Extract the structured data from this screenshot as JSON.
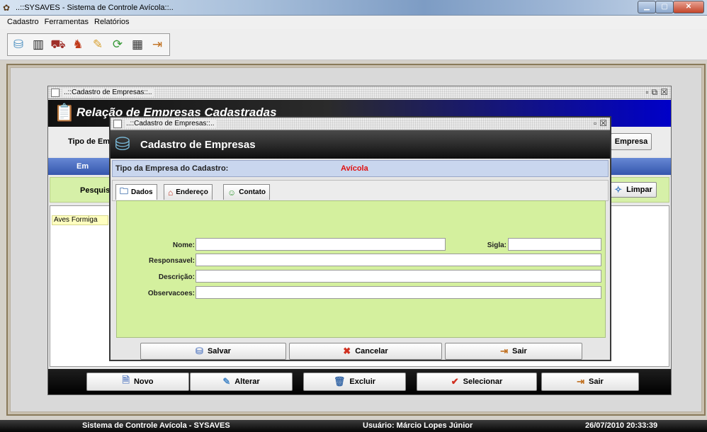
{
  "window": {
    "title": "..::SYSAVES - Sistema de Controle Avícola::.."
  },
  "menu": {
    "items": [
      "Cadastro",
      "Ferramentas",
      "Relatórios"
    ]
  },
  "toolbar": {
    "icons": [
      "database-icon",
      "barcode-icon",
      "truck-icon",
      "rooster-icon",
      "edit-icon",
      "refresh-icon",
      "calculator-icon",
      "exit-icon"
    ]
  },
  "relacao": {
    "window_title": "..::Cadastro de Empresas::..",
    "header_title": "Relação de Empresas Cadastradas",
    "tipo_label": "Tipo de Empr",
    "empresa_button": "Empresa",
    "column_header": "Em",
    "search_label": "Pesquisa",
    "limpar_button": "Limpar",
    "rows": [
      "Aves Formiga"
    ],
    "buttons": {
      "novo": "Novo",
      "alterar": "Alterar",
      "excluir": "Excluir",
      "selecionar": "Selecionar",
      "sair": "Sair"
    }
  },
  "cadastro": {
    "window_title": "..::Cadastro de Empresas::..",
    "header_title": "Cadastro de Empresas",
    "tipo_label": "Tipo da Empresa do Cadastro:",
    "tipo_value": "Avícola",
    "tabs": [
      "Dados",
      "Endereço",
      "Contato"
    ],
    "fields": {
      "nome": {
        "label": "Nome:",
        "value": ""
      },
      "sigla": {
        "label": "Sigla:",
        "value": ""
      },
      "responsavel": {
        "label": "Responsavel:",
        "value": ""
      },
      "descricao": {
        "label": "Descrição:",
        "value": ""
      },
      "observacoes": {
        "label": "Observacoes:",
        "value": ""
      }
    },
    "buttons": {
      "salvar": "Salvar",
      "cancelar": "Cancelar",
      "sair": "Sair"
    }
  },
  "status": {
    "system": "Sistema de Controle Avícola - SYSAVES",
    "user": "Usuário: Márcio Lopes Júnior",
    "datetime": "26/07/2010 20:33:39"
  },
  "colors": {
    "accent_blue": "#0000c8",
    "panel_green": "#d4f09e",
    "tipo_red": "#e01010"
  }
}
